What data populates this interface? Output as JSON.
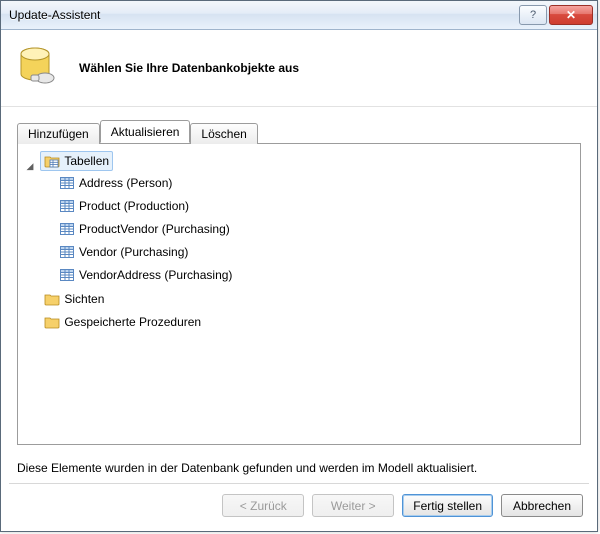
{
  "window": {
    "title": "Update-Assistent"
  },
  "header": {
    "title": "Wählen Sie Ihre Datenbankobjekte aus"
  },
  "tabs": {
    "add": "Hinzufügen",
    "refresh": "Aktualisieren",
    "delete": "Löschen"
  },
  "tree": {
    "tables_label": "Tabellen",
    "views_label": "Sichten",
    "sprocs_label": "Gespeicherte Prozeduren",
    "tables": [
      "Address (Person)",
      "Product (Production)",
      "ProductVendor (Purchasing)",
      "Vendor (Purchasing)",
      "VendorAddress (Purchasing)"
    ]
  },
  "info": "Diese Elemente wurden in der Datenbank gefunden und werden im Modell aktualisiert.",
  "buttons": {
    "back": "< Zurück",
    "next": "Weiter >",
    "finish": "Fertig stellen",
    "cancel": "Abbrechen"
  }
}
